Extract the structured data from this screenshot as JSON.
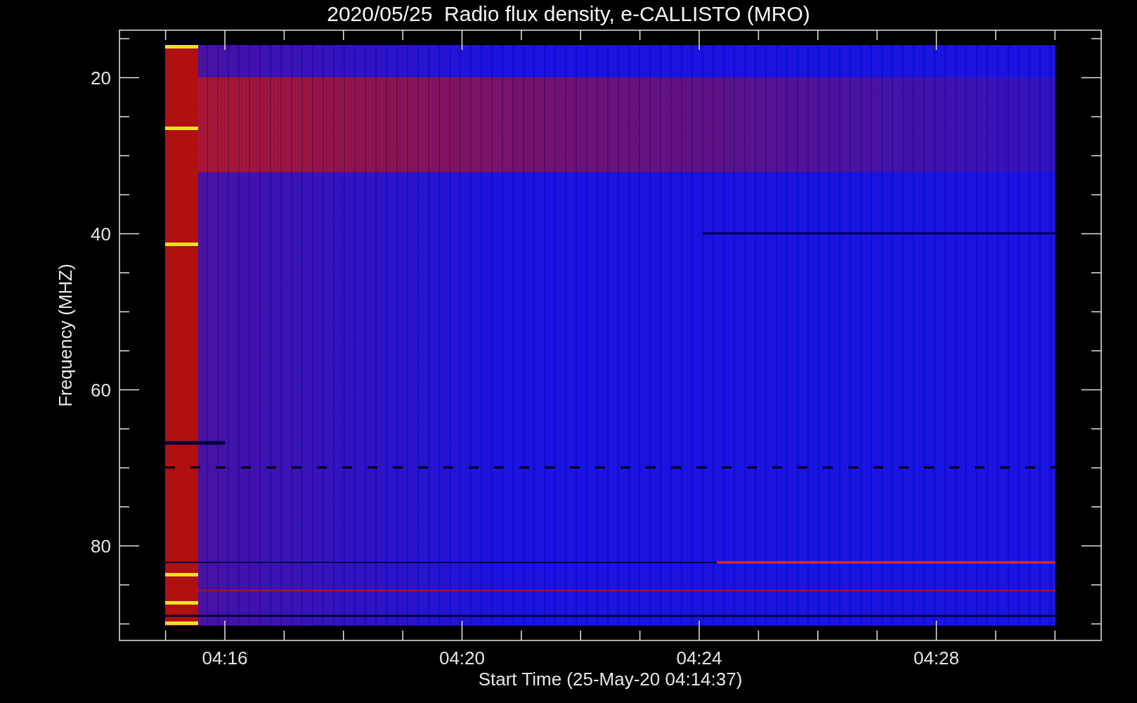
{
  "title": "2020/05/25  Radio flux density, e-CALLISTO (MRO)",
  "y_axis": {
    "label": "Frequency (MHZ)",
    "ticks": [
      "20",
      "40",
      "60",
      "80"
    ]
  },
  "x_axis": {
    "label": "Start Time (25-May-20 04:14:37)",
    "ticks": [
      "04:16",
      "04:20",
      "04:24",
      "04:28"
    ]
  }
}
